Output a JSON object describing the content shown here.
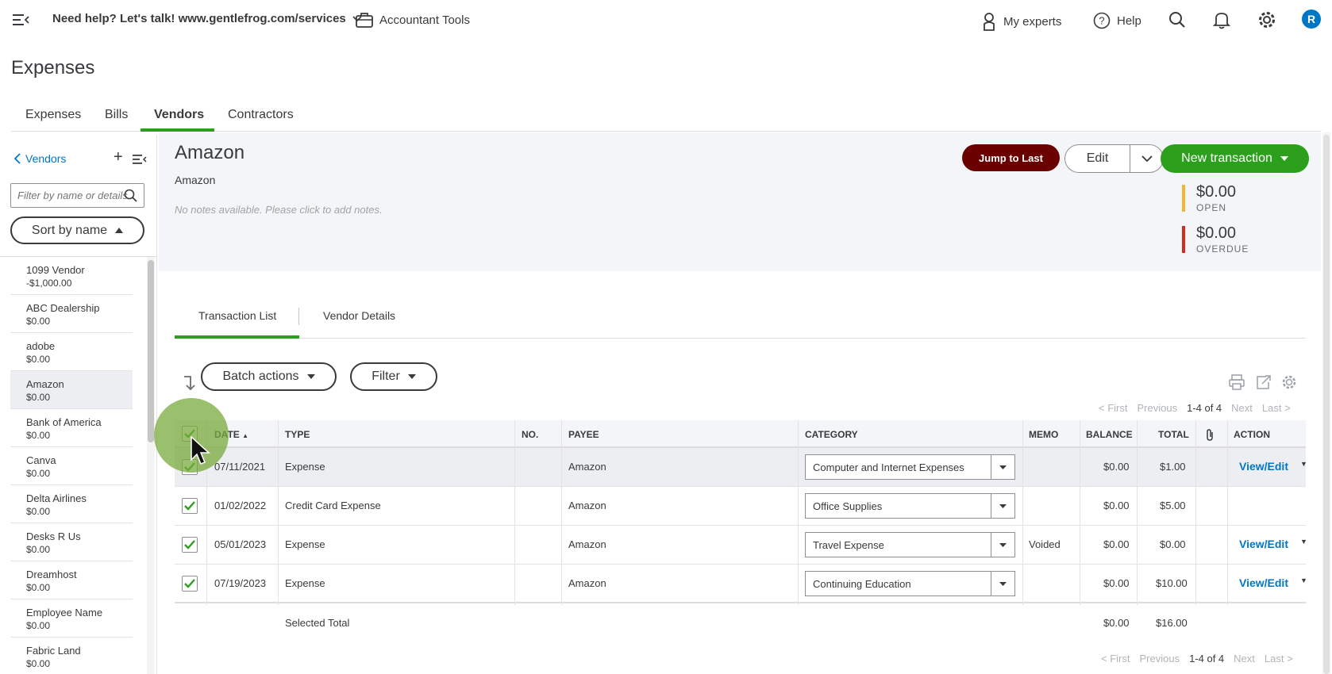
{
  "topbar": {
    "help_text": "Need help? Let's talk! www.gentlefrog.com/services",
    "accountant_tools": "Accountant Tools",
    "my_experts": "My experts",
    "help": "Help",
    "avatar_initial": "R"
  },
  "page": {
    "title": "Expenses"
  },
  "main_tabs": [
    "Expenses",
    "Bills",
    "Vendors",
    "Contractors"
  ],
  "sidebar": {
    "back_label": "Vendors",
    "search_placeholder": "Filter by name or details",
    "sort_label": "Sort by name",
    "vendors": [
      {
        "name": "1099 Vendor",
        "balance": "-$1,000.00"
      },
      {
        "name": "ABC Dealership",
        "balance": "$0.00"
      },
      {
        "name": "adobe",
        "balance": "$0.00"
      },
      {
        "name": "Amazon",
        "balance": "$0.00"
      },
      {
        "name": "Bank of America",
        "balance": "$0.00"
      },
      {
        "name": "Canva",
        "balance": "$0.00"
      },
      {
        "name": "Delta Airlines",
        "balance": "$0.00"
      },
      {
        "name": "Desks R Us",
        "balance": "$0.00"
      },
      {
        "name": "Dreamhost",
        "balance": "$0.00"
      },
      {
        "name": "Employee Name",
        "balance": "$0.00"
      },
      {
        "name": "Fabric Land",
        "balance": "$0.00"
      }
    ]
  },
  "vendor": {
    "name": "Amazon",
    "subtitle": "Amazon",
    "notes": "No notes available. Please click to add notes.",
    "jump_label": "Jump to Last",
    "edit_label": "Edit",
    "new_transaction_label": "New transaction",
    "open_value": "$0.00",
    "open_label": "OPEN",
    "overdue_value": "$0.00",
    "overdue_label": "OVERDUE",
    "open_color": "#f2b635",
    "overdue_color": "#d52b1e"
  },
  "sub_tabs": [
    "Transaction List",
    "Vendor Details"
  ],
  "toolbar": {
    "batch_label": "Batch actions",
    "filter_label": "Filter"
  },
  "pager": {
    "first": "< First",
    "previous": "Previous",
    "range": "1-4 of 4",
    "next": "Next",
    "last": "Last >"
  },
  "table": {
    "headers": {
      "date": "DATE",
      "type": "TYPE",
      "no": "NO.",
      "payee": "PAYEE",
      "category": "CATEGORY",
      "memo": "MEMO",
      "balance": "BALANCE",
      "total": "TOTAL",
      "action": "ACTION"
    },
    "rows": [
      {
        "date": "07/11/2021",
        "type": "Expense",
        "no": "",
        "payee": "Amazon",
        "category": "Computer and Internet Expenses",
        "memo": "",
        "balance": "$0.00",
        "total": "$1.00",
        "action": "View/Edit"
      },
      {
        "date": "01/02/2022",
        "type": "Credit Card Expense",
        "no": "",
        "payee": "Amazon",
        "category": "Office Supplies",
        "memo": "",
        "balance": "$0.00",
        "total": "$5.00",
        "action": ""
      },
      {
        "date": "05/01/2023",
        "type": "Expense",
        "no": "",
        "payee": "Amazon",
        "category": "Travel Expense",
        "memo": "Voided",
        "balance": "$0.00",
        "total": "$0.00",
        "action": "View/Edit"
      },
      {
        "date": "07/19/2023",
        "type": "Expense",
        "no": "",
        "payee": "Amazon",
        "category": "Continuing Education",
        "memo": "",
        "balance": "$0.00",
        "total": "$10.00",
        "action": "View/Edit"
      }
    ],
    "selected_total_label": "Selected Total",
    "selected_balance": "$0.00",
    "selected_total": "$16.00"
  }
}
